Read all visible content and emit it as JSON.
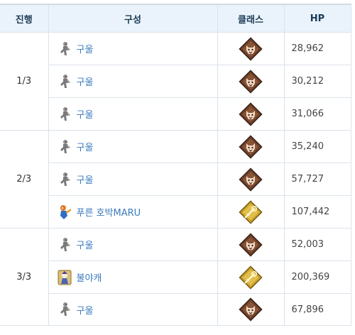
{
  "columns": {
    "wave": "진행",
    "composition": "구성",
    "class": "클래스",
    "hp": "HP"
  },
  "waves": [
    {
      "label": "1/3",
      "units": [
        {
          "name": "구울",
          "portrait": "ghoul-portrait-icon",
          "class": "beast-class-icon",
          "hp": "28,962"
        },
        {
          "name": "구울",
          "portrait": "ghoul-portrait-icon",
          "class": "beast-class-icon",
          "hp": "30,212"
        },
        {
          "name": "구울",
          "portrait": "ghoul-portrait-icon",
          "class": "beast-class-icon",
          "hp": "31,066"
        }
      ]
    },
    {
      "label": "2/3",
      "units": [
        {
          "name": "구울",
          "portrait": "ghoul-portrait-icon",
          "class": "beast-class-icon",
          "hp": "35,240"
        },
        {
          "name": "구울",
          "portrait": "ghoul-portrait-icon",
          "class": "beast-class-icon",
          "hp": "57,727"
        },
        {
          "name": "푸른 호박MARU",
          "portrait": "maru-portrait-icon",
          "class": "caster-class-icon",
          "hp": "107,442"
        }
      ]
    },
    {
      "label": "3/3",
      "units": [
        {
          "name": "구울",
          "portrait": "ghoul-portrait-icon",
          "class": "beast-class-icon",
          "hp": "52,003"
        },
        {
          "name": "불야캐",
          "portrait": "buryacae-portrait-icon",
          "class": "caster-class-icon",
          "hp": "200,369"
        },
        {
          "name": "구울",
          "portrait": "ghoul-portrait-icon",
          "class": "beast-class-icon",
          "hp": "67,896"
        }
      ]
    }
  ],
  "colors": {
    "header_bg": "#eaf3fb",
    "link": "#3a7bbf",
    "border": "#dbe2ea",
    "beast_badge": "#6b3f2a",
    "caster_badge": "#c9a12c"
  }
}
